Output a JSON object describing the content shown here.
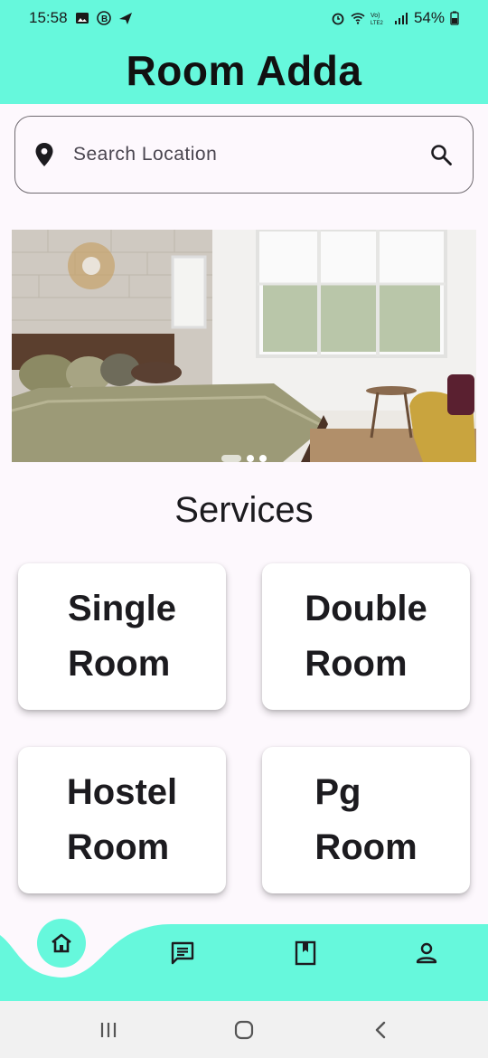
{
  "status_bar": {
    "time": "15:58",
    "battery": "54%"
  },
  "app": {
    "title": "Room Adda"
  },
  "search": {
    "placeholder": "Search Location"
  },
  "banner": {
    "image": "bedroom-photo",
    "slides": 3,
    "active_slide": 1
  },
  "services": {
    "title": "Services",
    "items": [
      {
        "label": "Single\nRoom"
      },
      {
        "label": "Double\nRoom"
      },
      {
        "label": "Hostel\nRoom"
      },
      {
        "label": "Pg\nRoom"
      }
    ]
  },
  "bottom_nav": {
    "items": [
      {
        "icon": "home-icon"
      },
      {
        "icon": "chat-icon"
      },
      {
        "icon": "bookmark-icon"
      },
      {
        "icon": "person-icon"
      }
    ]
  },
  "colors": {
    "accent": "#66f8dc",
    "background": "#fdf8fd",
    "text": "#1c1b1f"
  }
}
